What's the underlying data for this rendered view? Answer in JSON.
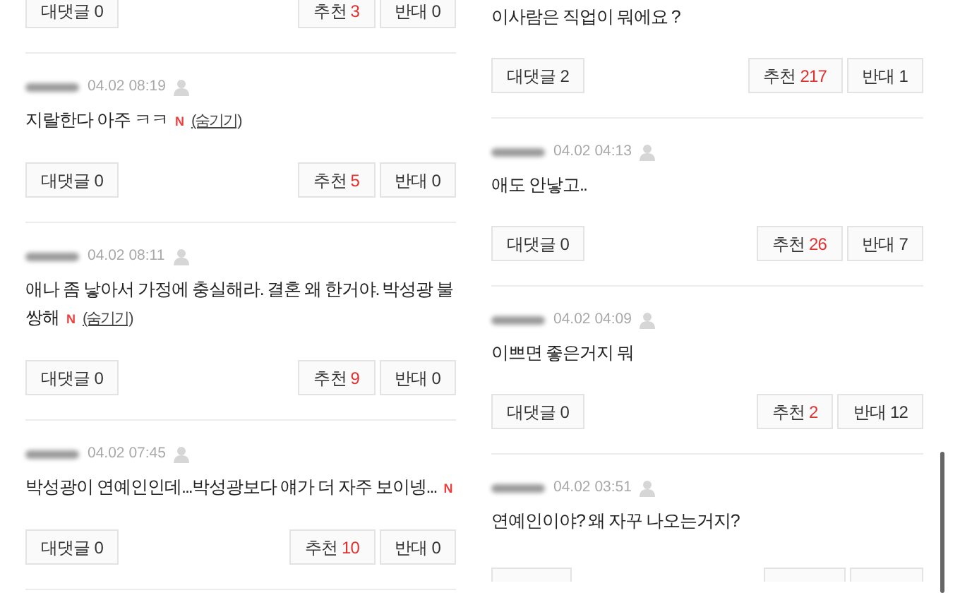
{
  "columns": [
    {
      "comments": [
        {
          "replies": "대댓글 0",
          "upvote_label": "추천",
          "upvotes": "3",
          "downvotes": "반대 0"
        },
        {
          "time": "04.02 08:19",
          "text": "지랄한다 아주 ㅋㅋ",
          "badge": "N",
          "hide_link": "(숨기기)",
          "replies": "대댓글 0",
          "upvote_label": "추천",
          "upvotes": "5",
          "downvotes": "반대 0"
        },
        {
          "time": "04.02 08:11",
          "text": "애나 좀 낳아서 가정에 충실해라. 결혼 왜 한거야. 박성광 불쌍해",
          "badge": "N",
          "hide_link": "(숨기기)",
          "replies": "대댓글 0",
          "upvote_label": "추천",
          "upvotes": "9",
          "downvotes": "반대 0"
        },
        {
          "time": "04.02 07:45",
          "text": "박성광이 연예인인데...박성광보다 얘가 더 자주 보이넹...",
          "badge": "N",
          "replies": "대댓글 0",
          "upvote_label": "추천",
          "upvotes": "10",
          "downvotes": "반대 0"
        }
      ]
    },
    {
      "comments": [
        {
          "text": "이사람은 직업이 뭐에요 ?",
          "replies": "대댓글 2",
          "upvote_label": "추천",
          "upvotes": "217",
          "downvotes": "반대 1"
        },
        {
          "time": "04.02 04:13",
          "text": "애도 안낳고..",
          "replies": "대댓글 0",
          "upvote_label": "추천",
          "upvotes": "26",
          "downvotes": "반대 7"
        },
        {
          "time": "04.02 04:09",
          "text": "이쁘면 좋은거지 뭐",
          "replies": "대댓글 0",
          "upvote_label": "추천",
          "upvotes": "2",
          "downvotes": "반대 12"
        },
        {
          "time": "04.02 03:51",
          "text": "연예인이야? 왜 자꾸 나오는거지?"
        }
      ]
    }
  ]
}
